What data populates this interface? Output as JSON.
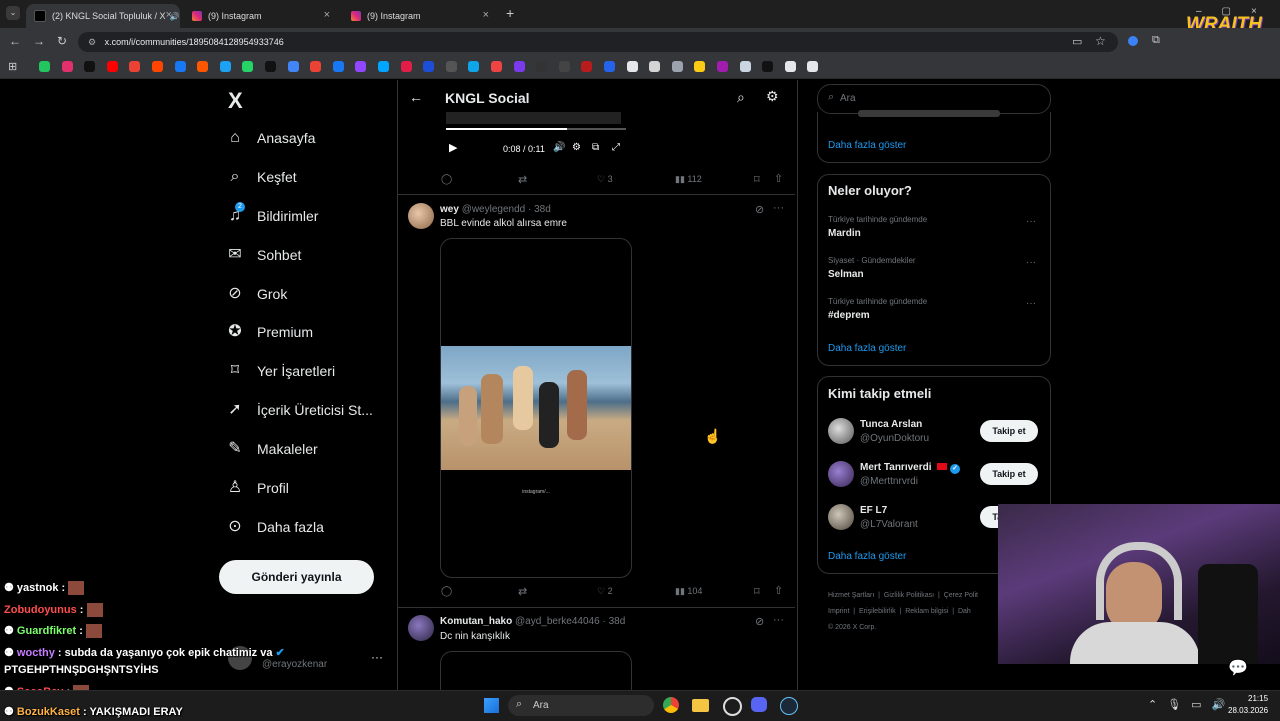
{
  "browser": {
    "tabs": [
      {
        "label": "(2) KNGL Social Topluluk / X",
        "active": true
      },
      {
        "label": "(9) Instagram",
        "active": false
      },
      {
        "label": "(9) Instagram",
        "active": false
      }
    ],
    "new_tab": "+",
    "url": "x.com/i/communities/1895084128954933746",
    "overlay_logo": "WRAITH"
  },
  "nav": {
    "logo": "X",
    "items": [
      {
        "label": "Anasayfa",
        "icon": "home-icon"
      },
      {
        "label": "Keşfet",
        "icon": "search-icon"
      },
      {
        "label": "Bildirimler",
        "icon": "bell-icon",
        "badge": "2"
      },
      {
        "label": "Sohbet",
        "icon": "mail-icon"
      },
      {
        "label": "Grok",
        "icon": "grok-icon"
      },
      {
        "label": "Premium",
        "icon": "premium-icon"
      },
      {
        "label": "Yer İşaretleri",
        "icon": "bookmark-icon"
      },
      {
        "label": "İçerik Üreticisi St...",
        "icon": "rocket-icon"
      },
      {
        "label": "Makaleler",
        "icon": "article-icon"
      },
      {
        "label": "Profil",
        "icon": "person-icon"
      },
      {
        "label": "Daha fazla",
        "icon": "more-circle-icon"
      }
    ],
    "post_button": "Gönderi yayınla",
    "account_handle": "@erayozkenar"
  },
  "community": {
    "title": "KNGL Social",
    "video": {
      "time": "0:08 / 0:11",
      "progress": 0.67
    },
    "posts": [
      {
        "stats": {
          "replies": "",
          "reposts": "",
          "likes": "3",
          "views": "112"
        }
      },
      {
        "name": "wey",
        "handle": "@weylegendd",
        "age": "38d",
        "text": "BBL evinde alkol alırsa emre",
        "video_caption": "instagram/...",
        "stats": {
          "likes": "2",
          "views": "104"
        }
      },
      {
        "name": "Komutan_hako",
        "handle": "@ayd_berke44046",
        "age": "38d",
        "text": "Dc nin kanşıklık"
      }
    ]
  },
  "sidebar": {
    "search_placeholder": "Ara",
    "top_more": "Daha fazla göster",
    "trends_title": "Neler oluyor?",
    "trends": [
      {
        "category": "Türkiye tarihinde gündemde",
        "name": "Mardin"
      },
      {
        "category": "Siyaset · Gündemdekiler",
        "name": "Selman"
      },
      {
        "category": "Türkiye tarihinde gündemde",
        "name": "#deprem"
      }
    ],
    "trends_more": "Daha fazla göster",
    "follow_title": "Kimi takip etmeli",
    "follow": [
      {
        "name": "Tunca Arslan",
        "handle": "@OyunDoktoru",
        "button": "Takip et"
      },
      {
        "name": "Mert Tanrıverdi",
        "handle": "@Merttnrvrdi",
        "button": "Takip et"
      },
      {
        "name": "EF L7",
        "handle": "@L7Valorant",
        "button": "Takip et"
      }
    ],
    "follow_more": "Daha fazla göster",
    "footer": [
      "Hizmet Şartları",
      "Gizlilik Politikası",
      "Çerez Polit",
      "Imprint",
      "Erişilebilirlik",
      "Reklam bilgisi",
      "Dah"
    ],
    "copyright": "© 2026 X Corp."
  },
  "chat": [
    {
      "user": "yastnok",
      "msg": "",
      "color": "#ffffff"
    },
    {
      "user": "Zobudoyunus",
      "msg": "",
      "color": "#ff4d4d"
    },
    {
      "user": "Guardfikret",
      "msg": "",
      "color": "#7cff6b"
    },
    {
      "user": "wocthy",
      "msg": "subda da yaşanıyo çok epik chatimiz va",
      "color": "#c77dff"
    },
    {
      "user": "",
      "msg": "PTGEHPTHNŞDGHŞNTSYİHS",
      "color": "#ffffff"
    },
    {
      "user": "SecoBey",
      "msg": "",
      "color": "#ff4d4d"
    },
    {
      "user": "BozukKaset",
      "msg": "YAKIŞMADI ERAY",
      "color": "#ffb347"
    }
  ],
  "taskbar": {
    "search": "Ara",
    "time": "21:15",
    "date": "28.03.2026"
  },
  "colors": {
    "accent": "#1d9bf0",
    "bg": "#000000",
    "border": "#2f3336",
    "muted": "#71767b"
  }
}
